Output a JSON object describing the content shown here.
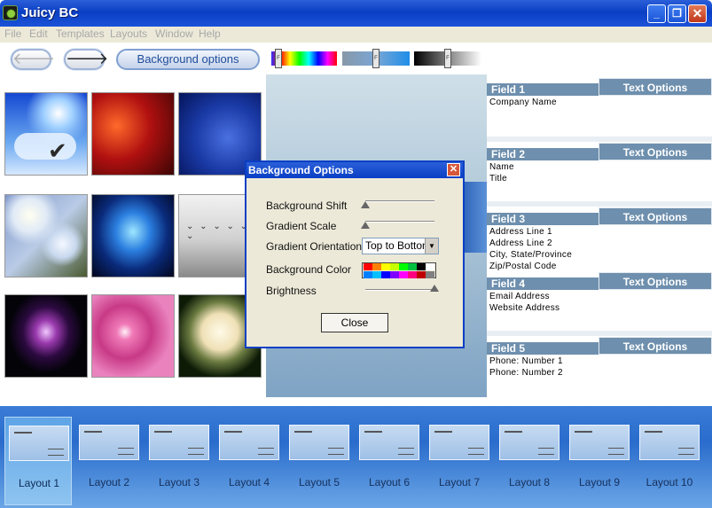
{
  "window": {
    "title": "Juicy BC"
  },
  "menu": [
    "File",
    "Edit",
    "Templates",
    "Layouts",
    "Window",
    "Help"
  ],
  "toolbar": {
    "back_icon": "arrow-left-icon",
    "forward_icon": "arrow-right-icon",
    "bg_options_label": "Background options",
    "hue_slider_label": "F",
    "shade_slider_label": "F",
    "brightness_slider_label": "F"
  },
  "thumbnails": [
    {
      "name": "cloud-sun-checkmark",
      "colors": [
        "#0e3cb2",
        "#7fb2ff",
        "#ffffff"
      ]
    },
    {
      "name": "red-texture",
      "colors": [
        "#4a0606",
        "#b31818",
        "#f05020"
      ]
    },
    {
      "name": "blue-texture",
      "colors": [
        "#041a5e",
        "#1c3fb0",
        "#4066d8"
      ]
    },
    {
      "name": "blossom-branch",
      "colors": [
        "#6880b8",
        "#d8e4f2",
        "#3a4a28"
      ]
    },
    {
      "name": "blue-reef",
      "colors": [
        "#030820",
        "#1a5bd0",
        "#7fd8ff"
      ]
    },
    {
      "name": "birds-over-water",
      "colors": [
        "#e2e2e2",
        "#bdbdbd",
        "#5a5a5a"
      ]
    },
    {
      "name": "nebula",
      "colors": [
        "#02020a",
        "#8c3a9e",
        "#ffffff"
      ]
    },
    {
      "name": "pink-flowers",
      "colors": [
        "#b52c7a",
        "#ea6aad",
        "#ffe0f0"
      ]
    },
    {
      "name": "white-rose",
      "colors": [
        "#0a1a05",
        "#e8d9b0",
        "#fff5d9"
      ]
    }
  ],
  "fields": [
    {
      "title": "Field 1",
      "options": "Text Options",
      "lines": [
        "Company Name"
      ]
    },
    {
      "title": "Field 2",
      "options": "Text Options",
      "lines": [
        "Name",
        "Title"
      ]
    },
    {
      "title": "Field 3",
      "options": "Text Options",
      "lines": [
        "Address Line 1",
        "Address Line 2",
        "City, State/Province",
        "Zip/Postal Code"
      ]
    },
    {
      "title": "Field 4",
      "options": "Text Options",
      "lines": [
        "Email Address",
        "Website Address"
      ]
    },
    {
      "title": "Field 5",
      "options": "Text Options",
      "lines": [
        "Phone: Number 1",
        "Phone: Number 2"
      ]
    }
  ],
  "dialog": {
    "title": "Background Options",
    "labels": {
      "shift": "Background Shift",
      "scale": "Gradient Scale",
      "orientation": "Gradient Orientation",
      "color": "Background Color",
      "brightness": "Brightness"
    },
    "shift_value": 0.0,
    "scale_value": 0.0,
    "brightness_value": 1.0,
    "orientation_value": "Top to Bottom",
    "swatch_colors": [
      "#ff0000",
      "#ff8000",
      "#ffff00",
      "#c8ff00",
      "#00ff00",
      "#00c040",
      "#000000",
      "#ffffff",
      "#0080ff",
      "#00c0ff",
      "#0000ff",
      "#8000ff",
      "#ff00ff",
      "#ff0080",
      "#c00000",
      "#808080"
    ],
    "close_label": "Close"
  },
  "layouts": {
    "selected": 0,
    "items": [
      "Layout 1",
      "Layout 2",
      "Layout 3",
      "Layout 4",
      "Layout 5",
      "Layout 6",
      "Layout 7",
      "Layout 8",
      "Layout 9",
      "Layout 10"
    ]
  }
}
